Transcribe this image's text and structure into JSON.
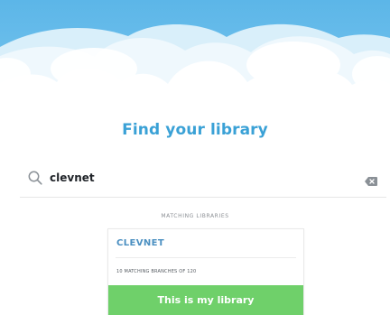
{
  "screen": {
    "title": "Find your library"
  },
  "search": {
    "value": "clevnet"
  },
  "results": {
    "section_label": "MATCHING LIBRARIES",
    "libraries": [
      {
        "name": "CLEVNET",
        "branch_count": "10 MATCHING BRANCHES OF 120",
        "action_label": "This is my library"
      }
    ]
  },
  "icons": {
    "search": "search-icon",
    "clear": "backspace-icon"
  },
  "colors": {
    "accent": "#3aa1d6",
    "sky": "#62b8e9",
    "button": "#6fd06a",
    "card_title": "#4a8fc1"
  }
}
